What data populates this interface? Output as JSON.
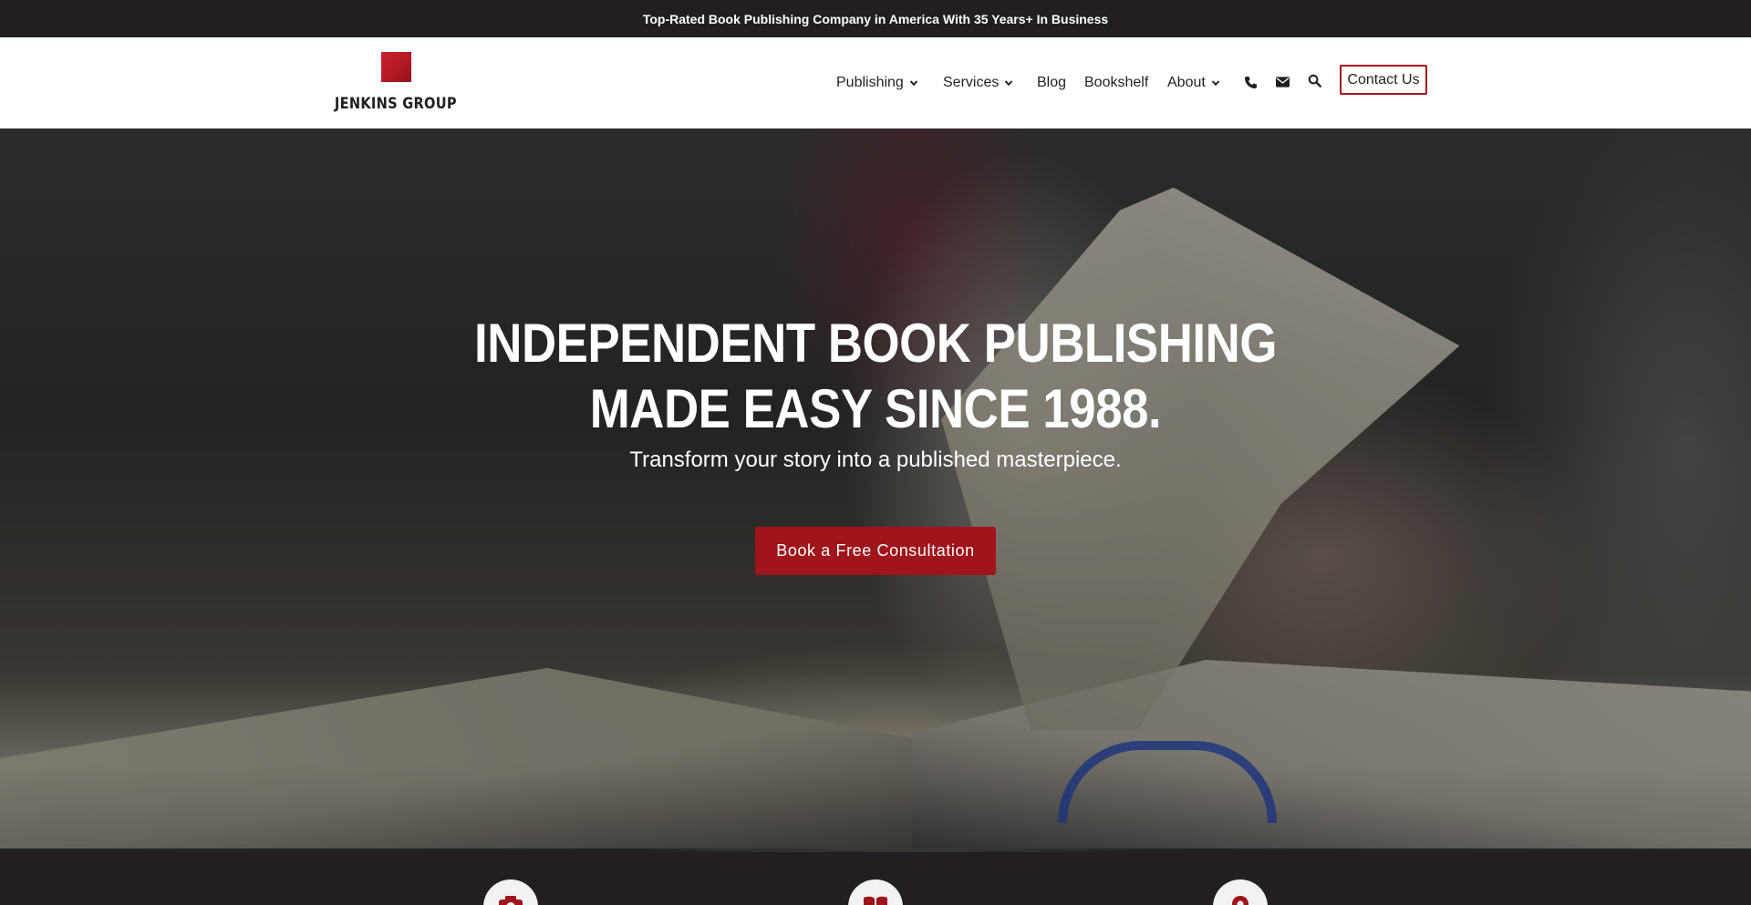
{
  "topbar": {
    "text": "Top-Rated Book Publishing Company in America With 35 Years+ In Business"
  },
  "header": {
    "logo_text": "JENKINS GROUP",
    "nav": [
      {
        "label": "Publishing",
        "has_dropdown": true
      },
      {
        "label": "Services",
        "has_dropdown": true
      },
      {
        "label": "Blog",
        "has_dropdown": false
      },
      {
        "label": "Bookshelf",
        "has_dropdown": false
      },
      {
        "label": "About",
        "has_dropdown": true
      }
    ],
    "icons": [
      "phone-icon",
      "envelope-icon",
      "search-icon"
    ],
    "contact_label": "Contact Us"
  },
  "hero": {
    "title_line1": "INDEPENDENT BOOK PUBLISHING",
    "title_line2": "MADE EASY SINCE 1988.",
    "subtitle": "Transform your story into a published masterpiece.",
    "cta_label": "Book a Free Consultation"
  },
  "features": {
    "icons": [
      "camera-icon",
      "open-book-icon",
      "map-pin-icon"
    ]
  },
  "colors": {
    "brand_red": "#a0141c",
    "dark": "#231f20",
    "white": "#ffffff"
  }
}
